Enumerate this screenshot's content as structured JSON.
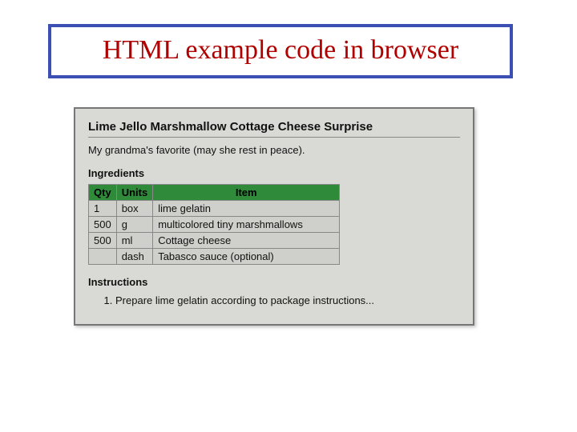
{
  "title": "HTML example code in browser",
  "recipe": {
    "heading": "Lime Jello Marshmallow Cottage Cheese Surprise",
    "subtitle": "My grandma's favorite (may she rest in peace).",
    "ingredients_label": "Ingredients",
    "instructions_label": "Instructions",
    "columns": {
      "qty": "Qty",
      "units": "Units",
      "item": "Item"
    },
    "rows": [
      {
        "qty": "1",
        "units": "box",
        "item": "lime gelatin"
      },
      {
        "qty": "500",
        "units": "g",
        "item": "multicolored tiny marshmallows"
      },
      {
        "qty": "500",
        "units": "ml",
        "item": "Cottage cheese"
      },
      {
        "qty": "",
        "units": "dash",
        "item": "Tabasco sauce (optional)"
      }
    ],
    "steps": [
      "Prepare lime gelatin according to package instructions..."
    ]
  }
}
